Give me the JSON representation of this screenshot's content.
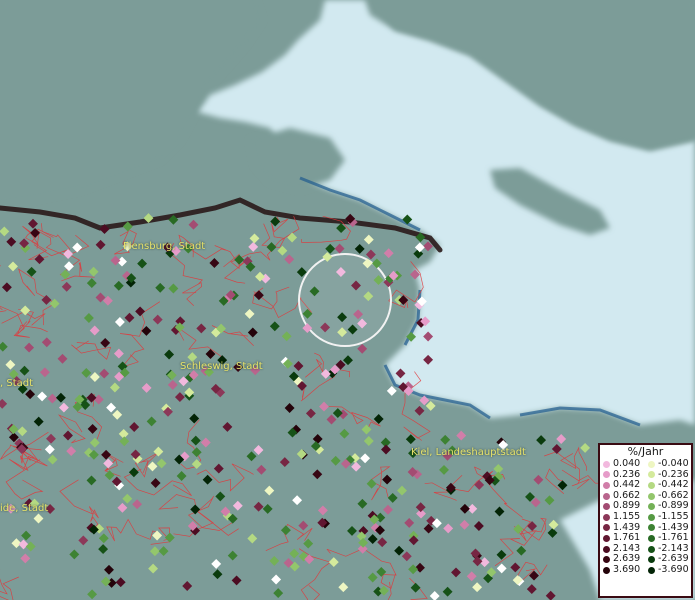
{
  "map": {
    "places": [
      {
        "id": "flensburg",
        "label": "Flensburg, Stadt"
      },
      {
        "id": "schleswig",
        "label": "Schleswig, Stadt"
      },
      {
        "id": "kiel",
        "label": "Kiel, Landeshauptstadt"
      },
      {
        "id": "west1",
        "label": ", Stadt"
      },
      {
        "id": "west2",
        "label": "ide, Stadt"
      }
    ],
    "colors": {
      "land": "#7c9c98",
      "water": "#d2e9f0",
      "border": "#e2373a",
      "place_label": "#e6e26a",
      "frontier": "#2a1a1a"
    }
  },
  "legend": {
    "title": "%/Jahr",
    "positive": [
      {
        "label": "0.040",
        "color": "#f2b9de"
      },
      {
        "label": "0.236",
        "color": "#e69cc9"
      },
      {
        "label": "0.442",
        "color": "#d17ea9"
      },
      {
        "label": "0.662",
        "color": "#b9658d"
      },
      {
        "label": "0.899",
        "color": "#a34c72"
      },
      {
        "label": "1.155",
        "color": "#8c3859"
      },
      {
        "label": "1.439",
        "color": "#772643"
      },
      {
        "label": "1.761",
        "color": "#611631"
      },
      {
        "label": "2.143",
        "color": "#4c0c22"
      },
      {
        "label": "2.639",
        "color": "#370613"
      },
      {
        "label": "3.690",
        "color": "#24030a"
      }
    ],
    "negative": [
      {
        "label": "-0.040",
        "color": "#eef6c2"
      },
      {
        "label": "-0.236",
        "color": "#d4ea9c"
      },
      {
        "label": "-0.442",
        "color": "#b4d982"
      },
      {
        "label": "-0.662",
        "color": "#93c66c"
      },
      {
        "label": "-0.899",
        "color": "#74b157"
      },
      {
        "label": "-1.155",
        "color": "#569a44"
      },
      {
        "label": "-1.439",
        "color": "#3d8233"
      },
      {
        "label": "-1.761",
        "color": "#286a24"
      },
      {
        "label": "-2.143",
        "color": "#165217"
      },
      {
        "label": "-2.639",
        "color": "#0a3b0d"
      },
      {
        "label": "-3.690",
        "color": "#032406"
      }
    ]
  }
}
